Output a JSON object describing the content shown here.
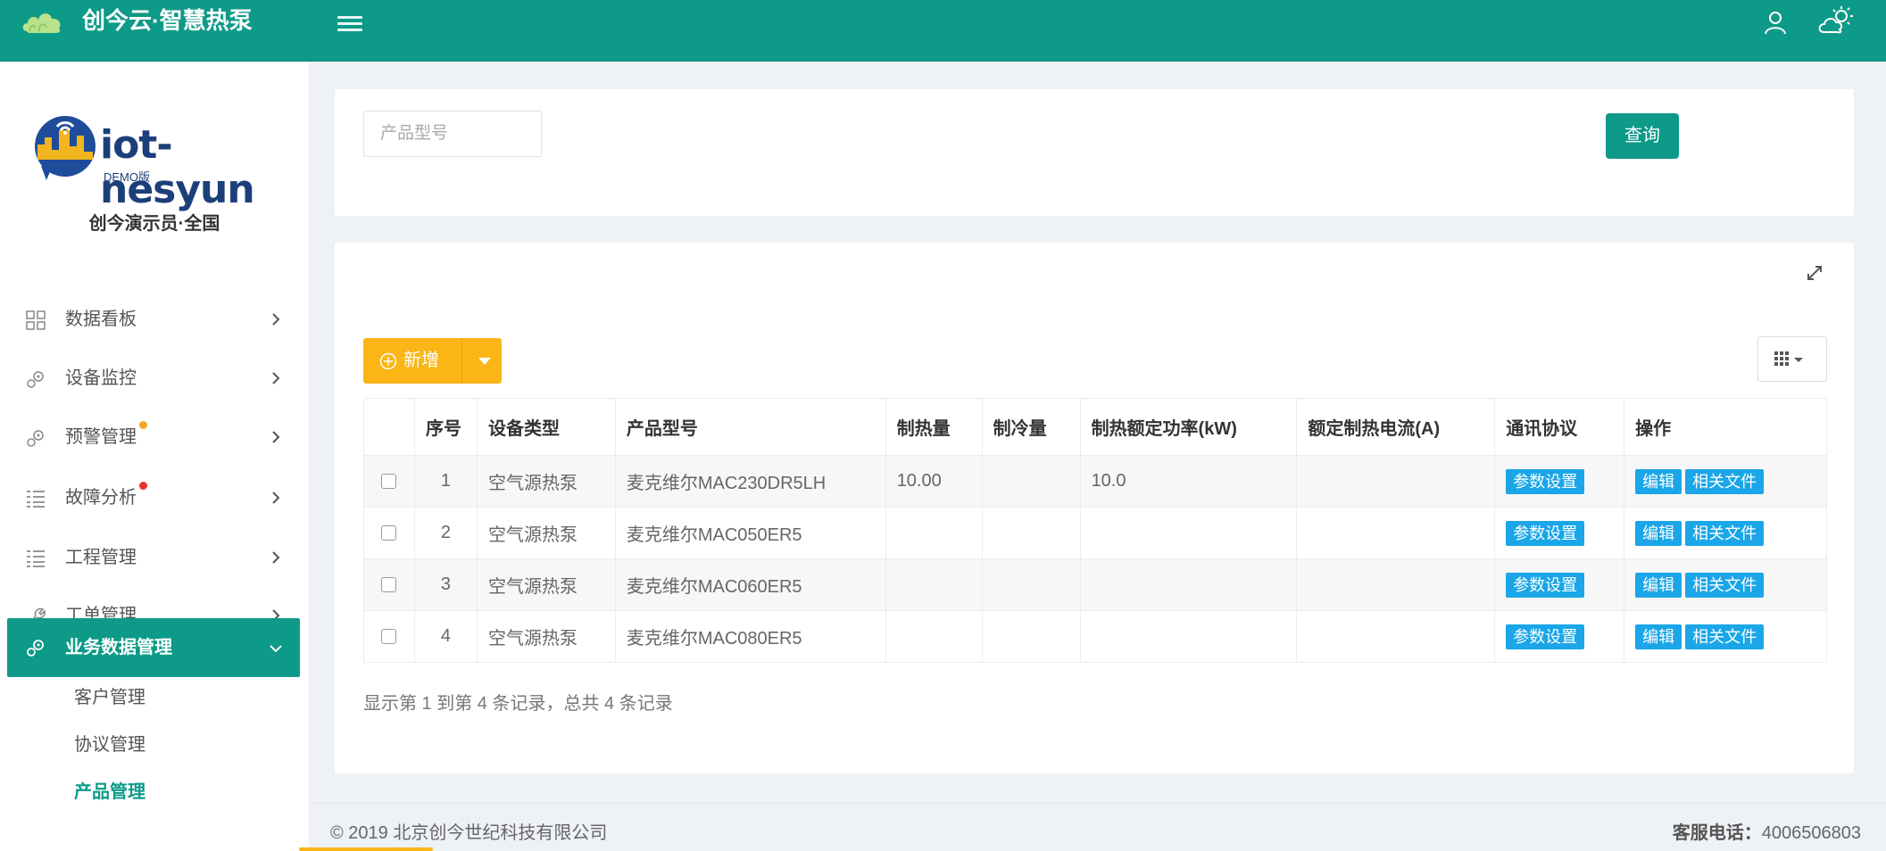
{
  "app": {
    "title": "创今云·智慧热泵"
  },
  "brand": {
    "name": "iot-nesyun",
    "edition": "DEMO版"
  },
  "user": {
    "display_name": "创今演示员·全国"
  },
  "sidebar": {
    "items": [
      {
        "label": "数据看板",
        "icon": "dashboard-grid-icon"
      },
      {
        "label": "设备监控",
        "icon": "gears-icon"
      },
      {
        "label": "预警管理",
        "icon": "gears-icon",
        "badge_color": "#f5a623"
      },
      {
        "label": "故障分析",
        "icon": "list-icon",
        "badge_color": "#e8312b"
      },
      {
        "label": "工程管理",
        "icon": "list-icon"
      },
      {
        "label": "工单管理",
        "icon": "wrench-icon"
      },
      {
        "label": "业务数据管理",
        "icon": "gears-icon",
        "expanded": true
      }
    ],
    "subitems": [
      {
        "label": "客户管理"
      },
      {
        "label": "协议管理"
      },
      {
        "label": "产品管理",
        "active": true
      }
    ]
  },
  "search": {
    "placeholder": "产品型号",
    "button_label": "查询"
  },
  "toolbar": {
    "add_label": "新增"
  },
  "table": {
    "headers": [
      "",
      "序号",
      "设备类型",
      "产品型号",
      "制热量",
      "制冷量",
      "制热额定功率(kW)",
      "额定制热电流(A)",
      "通讯协议",
      "操作"
    ],
    "rows": [
      {
        "index": "1",
        "type": "空气源热泵",
        "model": "麦克维尔MAC230DR5LH",
        "heating": "10.00",
        "cooling": "",
        "power": "10.0",
        "current": "",
        "protocol_btn": "参数设置",
        "edit_btn": "编辑",
        "files_btn": "相关文件"
      },
      {
        "index": "2",
        "type": "空气源热泵",
        "model": "麦克维尔MAC050ER5",
        "heating": "",
        "cooling": "",
        "power": "",
        "current": "",
        "protocol_btn": "参数设置",
        "edit_btn": "编辑",
        "files_btn": "相关文件"
      },
      {
        "index": "3",
        "type": "空气源热泵",
        "model": "麦克维尔MAC060ER5",
        "heating": "",
        "cooling": "",
        "power": "",
        "current": "",
        "protocol_btn": "参数设置",
        "edit_btn": "编辑",
        "files_btn": "相关文件"
      },
      {
        "index": "4",
        "type": "空气源热泵",
        "model": "麦克维尔MAC080ER5",
        "heating": "",
        "cooling": "",
        "power": "",
        "current": "",
        "protocol_btn": "参数设置",
        "edit_btn": "编辑",
        "files_btn": "相关文件"
      }
    ],
    "summary": "显示第 1 到第 4 条记录，总共 4 条记录"
  },
  "footer": {
    "copyright": "© 2019 北京创今世纪科技有限公司",
    "hotline_label": "客服电话：",
    "hotline_number": "4006506803"
  },
  "colors": {
    "primary": "#0d9a88",
    "warning": "#fbb515",
    "tag": "#1aa6e8"
  }
}
